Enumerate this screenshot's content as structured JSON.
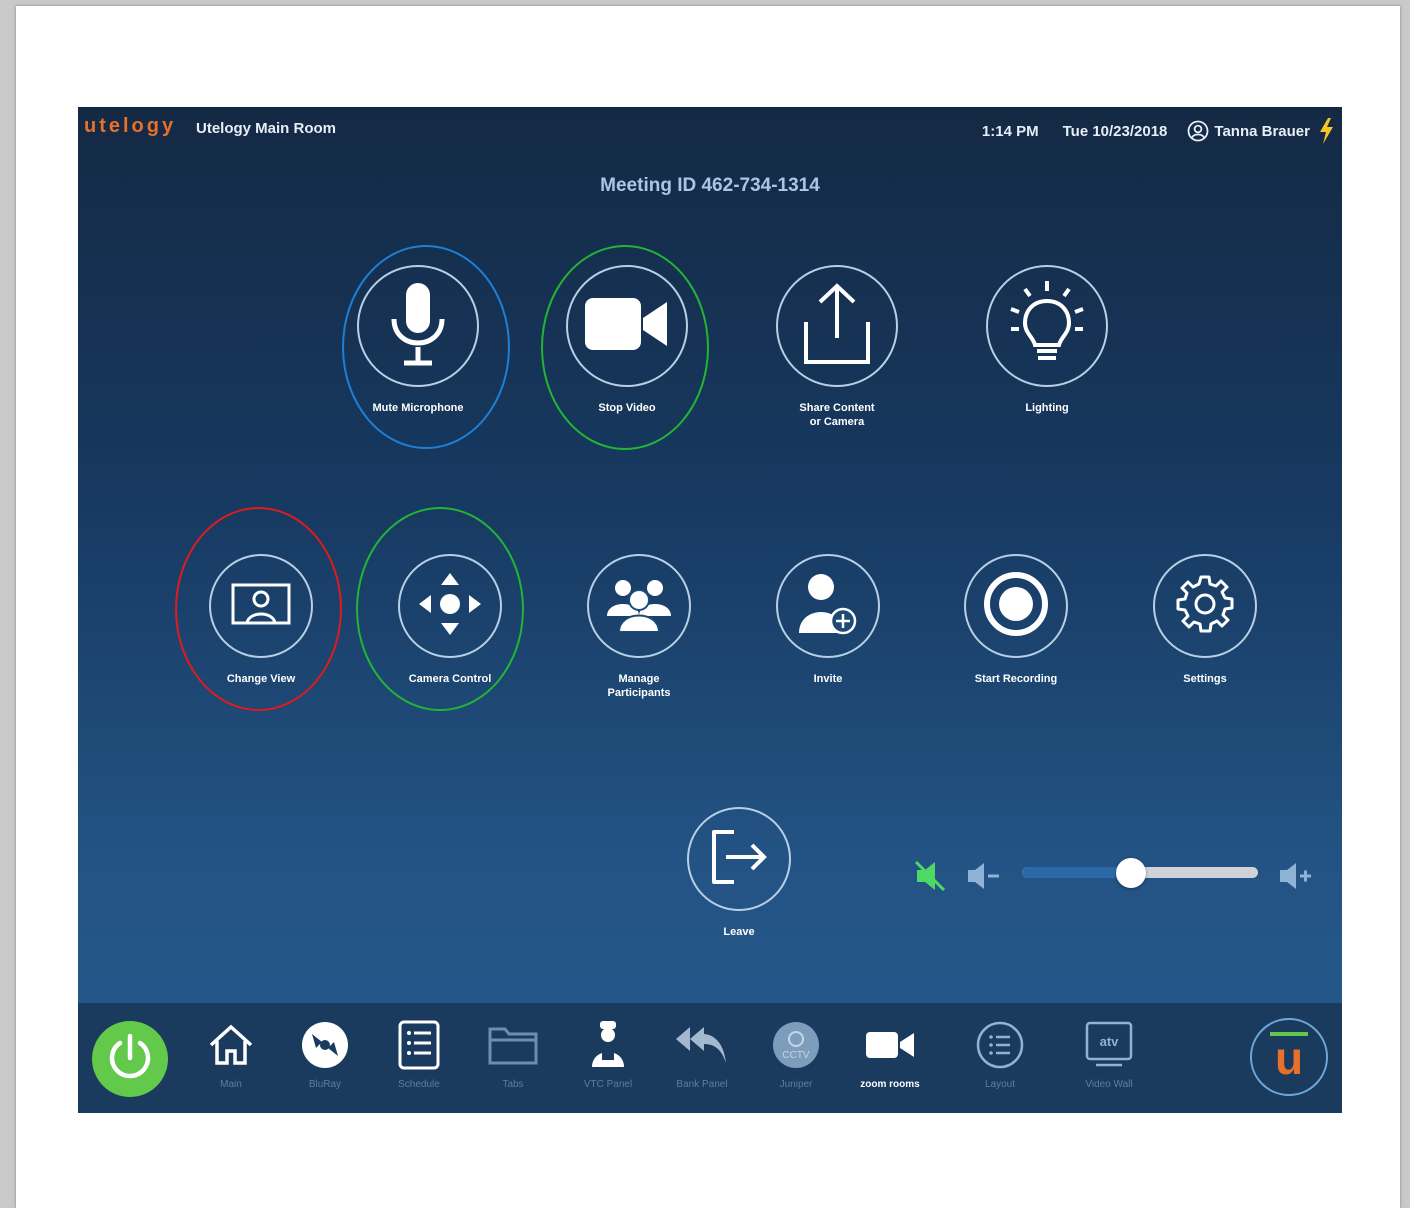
{
  "header": {
    "logo_text": "utelogy",
    "room_name": "Utelogy Main Room",
    "time": "1:14 PM",
    "date": "Tue 10/23/2018",
    "user": "Tanna Brauer"
  },
  "meeting": {
    "id_text": "Meeting ID 462-734-1314"
  },
  "controls_row1": [
    {
      "label": "Mute Microphone",
      "icon": "microphone-icon"
    },
    {
      "label": "Stop Video",
      "icon": "video-camera-icon"
    },
    {
      "label": "Share Content or Camera",
      "icon": "share-upload-icon"
    },
    {
      "label": "Lighting",
      "icon": "lightbulb-icon"
    }
  ],
  "controls_row2": [
    {
      "label": "Change View",
      "icon": "change-view-icon"
    },
    {
      "label": "Camera Control",
      "icon": "camera-control-icon"
    },
    {
      "label": "Manage Participants",
      "icon": "participants-icon"
    },
    {
      "label": "Invite",
      "icon": "invite-user-icon"
    },
    {
      "label": "Start Recording",
      "icon": "record-icon"
    },
    {
      "label": "Settings",
      "icon": "gear-icon"
    }
  ],
  "leave": {
    "label": "Leave",
    "icon": "exit-icon"
  },
  "volume": {
    "level": 0.46,
    "muted_icon_color": "#4cd964"
  },
  "nav_items": [
    {
      "label": "Main",
      "icon": "home-icon"
    },
    {
      "label": "BluRay",
      "icon": "disc-icon"
    },
    {
      "label": "Schedule",
      "icon": "schedule-list-icon"
    },
    {
      "label": "Tabs",
      "icon": "folder-icon"
    },
    {
      "label": "VTC Panel",
      "icon": "vtc-person-icon"
    },
    {
      "label": "Bank Panel",
      "icon": "reply-all-icon"
    },
    {
      "label": "Juniper",
      "icon": "cctv-icon"
    },
    {
      "label": "zoom rooms",
      "icon": "zoom-camera-icon",
      "active": true
    },
    {
      "label": "Layout",
      "icon": "layout-list-icon"
    },
    {
      "label": "Video Wall",
      "icon": "atv-icon"
    }
  ],
  "footer": {
    "brand_letter": "u"
  },
  "colors": {
    "brand_orange": "#e8702a",
    "power_green": "#62c94a",
    "annotation_blue": "#1f7fd6",
    "annotation_green": "#22b533",
    "annotation_red": "#e01b1b"
  }
}
